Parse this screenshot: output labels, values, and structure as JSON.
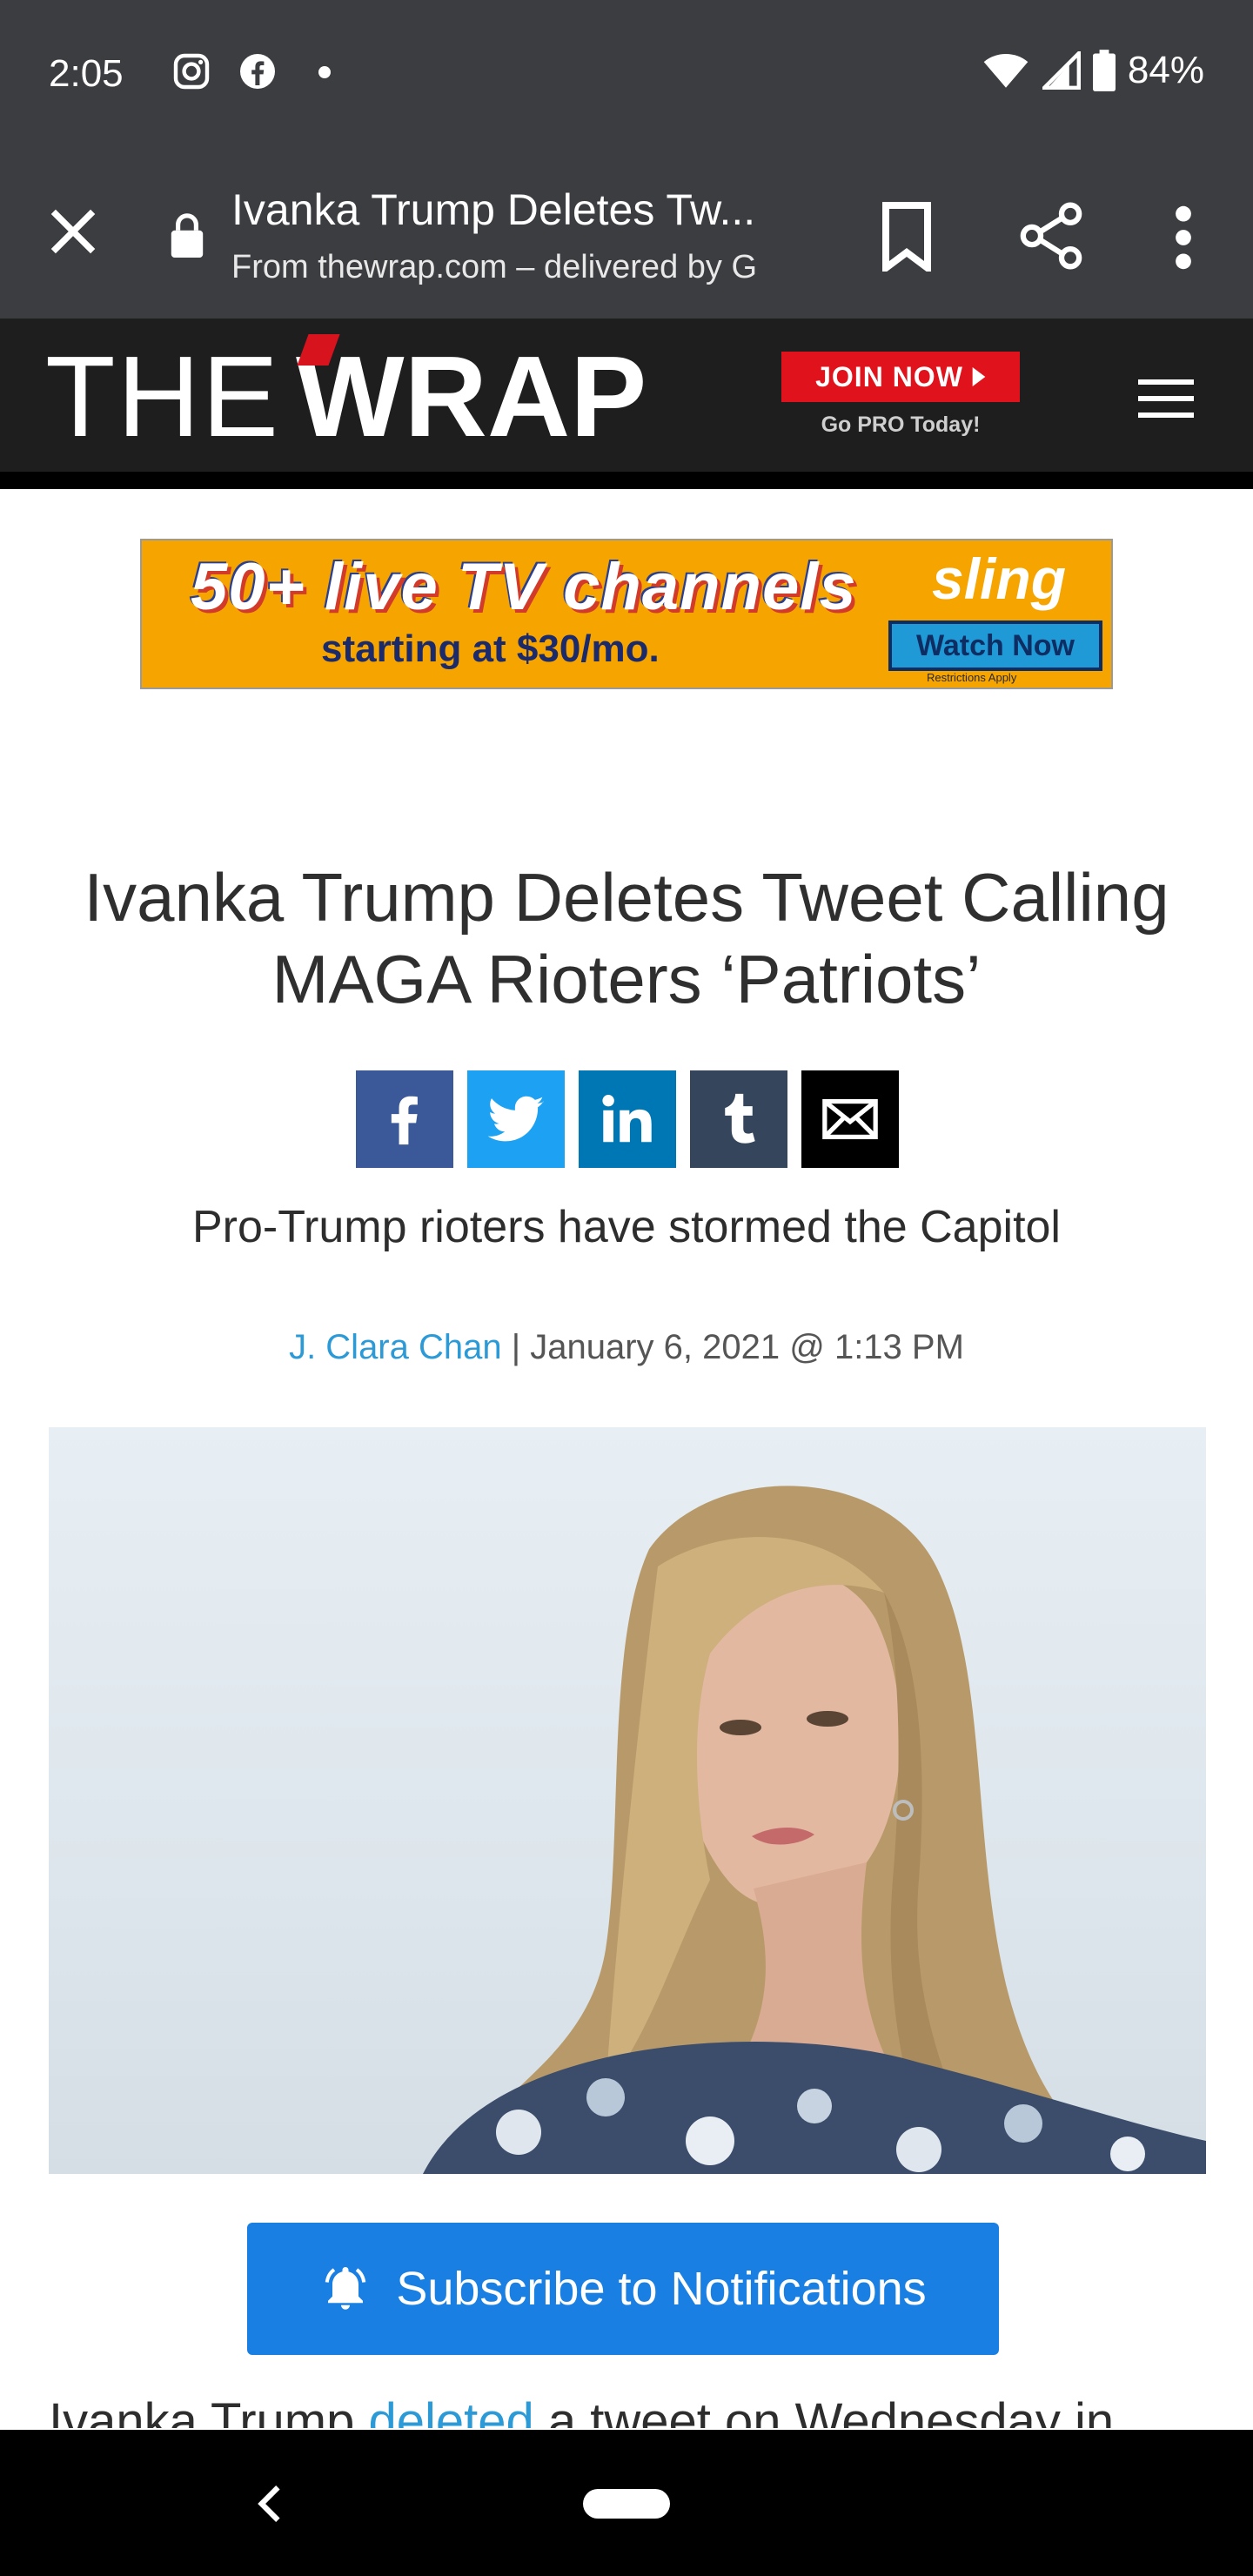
{
  "status_bar": {
    "time": "2:05",
    "battery": "84%",
    "left_icons": [
      "instagram-icon",
      "facebook-icon",
      "notification-dot-icon"
    ],
    "right_icons": [
      "wifi-icon",
      "cell-signal-icon",
      "battery-icon"
    ]
  },
  "custom_tab": {
    "title": "Ivanka Trump Deletes Tw...",
    "subtitle": "From thewrap.com – delivered by G",
    "icons": [
      "close-icon",
      "lock-icon",
      "bookmark-icon",
      "share-icon",
      "more-vert-icon"
    ]
  },
  "site_header": {
    "logo_the": "THE",
    "logo_wrap": "WRAP",
    "join_label": "JOIN NOW",
    "go_pro": "Go PRO Today!",
    "brand_red": "#e0121c"
  },
  "ad": {
    "line1": "50+ live TV channels",
    "line2": "starting at $30/mo.",
    "brand": "sling",
    "cta": "Watch Now",
    "fine_print": "Restrictions Apply",
    "bg_color": "#f6a400"
  },
  "article": {
    "headline": "Ivanka Trump Deletes Tweet Calling MAGA Rioters ‘Patriots’",
    "subtitle": "Pro-Trump rioters have stormed the Capitol",
    "author": "J. Clara Chan",
    "date": " | January 6, 2021 @ 1:13 PM",
    "share_buttons": [
      "facebook",
      "twitter",
      "linkedin",
      "tumblr",
      "email"
    ],
    "body_start": "Ivanka Trump ",
    "body_link": "deleted",
    "body_rest": " a tweet on Wednesday in"
  },
  "subscribe": {
    "label": "Subscribe to Notifications",
    "color": "#1a7fe3"
  },
  "nav_bar": {
    "icons": [
      "back-icon",
      "home-pill-icon"
    ]
  }
}
